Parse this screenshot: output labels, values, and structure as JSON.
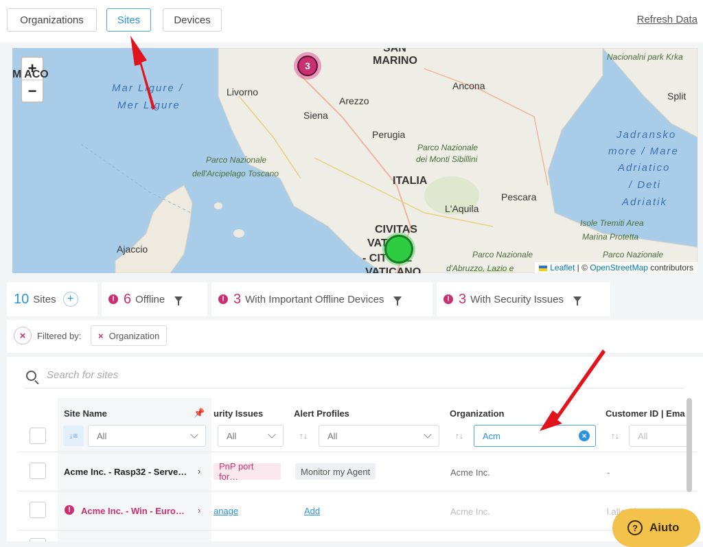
{
  "topbar": {
    "tabs": [
      {
        "label": "Organizations"
      },
      {
        "label": "Sites"
      },
      {
        "label": "Devices"
      }
    ],
    "refresh_label": "Refresh Data"
  },
  "map": {
    "zoom_in": "+",
    "zoom_out": "−",
    "labels": {
      "marino_top": "SAN",
      "marino": "MARINO",
      "nacionalni": "Nacionalni park Krka",
      "monaco": "M  ACO",
      "mar_ligure_1": "Mar Ligure /",
      "mar_ligure_2": "Mer Ligure",
      "livorno": "Livorno",
      "ancona": "Ancona",
      "arezzo": "Arezzo",
      "split": "Split",
      "siena": "Siena",
      "perugia": "Perugia",
      "parco_sibillini_1": "Parco Nazionale",
      "parco_sibillini_2": "dei Monti Sibillini",
      "adriatic_1": "Jadransko",
      "adriatic_2": "more / Mare",
      "adriatic_3": "Adriatico",
      "adriatic_4": "/ Deti",
      "adriatic_5": "Adriatik",
      "arcipelago_1": "Parco Nazionale",
      "arcipelago_2": "dell'Arcipelago Toscano",
      "italia": "ITALIA",
      "pescara": "Pescara",
      "laquila": "L'Aquila",
      "tremiti_1": "Isole Tremiti Area",
      "tremiti_2": "Marina Protetta",
      "civitas_1": "CIVITAS",
      "civitas_2": "VAT    NA",
      "civitas_3": "- CIT    DEL",
      "civitas_4": "VATICANO",
      "ajaccio": "Ajaccio",
      "abruzzo_1": "Parco Nazionale",
      "abruzzo_2": "d'Abruzzo, Lazio e",
      "parco_right": "Parco Nazionale"
    },
    "cluster_count": "3",
    "attribution": {
      "leaflet": "Leaflet",
      "separator": " | © ",
      "osm": "OpenStreetMap",
      "contributors": " contributors"
    }
  },
  "stats": {
    "sites": {
      "num": "10",
      "label": "Sites"
    },
    "offline": {
      "num": "6",
      "label": "Offline"
    },
    "important": {
      "num": "3",
      "label": "With Important Offline Devices"
    },
    "security": {
      "num": "3",
      "label": "With Security Issues"
    }
  },
  "filters": {
    "label": "Filtered by:",
    "chip": "Organization"
  },
  "table": {
    "search_placeholder": "Search for sites",
    "headers": {
      "site_name": "Site Name",
      "security": "urity Issues",
      "alert_profiles": "Alert Profiles",
      "organization": "Organization",
      "customer": "Customer ID | Ema"
    },
    "filters": {
      "site_name": "All",
      "security": "All",
      "alert_profiles": "All",
      "organization": "Acm",
      "customer": "All"
    },
    "rows": [
      {
        "name": "Acme Inc. - Rasp32 - Serve…",
        "security": "PnP port for…",
        "alert": "Monitor my Agent",
        "organization": "Acme Inc.",
        "customer": "-"
      },
      {
        "name": "Acme Inc. - Win - Euro…",
        "security": "anage",
        "alert": "Add",
        "organization": "Acme Inc.",
        "customer": "l.allen@gmail.com"
      }
    ]
  },
  "help": {
    "label": "Aiuto"
  },
  "colors": {
    "accent": "#2a93df",
    "alert": "#c8306f",
    "help": "#f2c24a",
    "arrow": "#e0141a"
  }
}
